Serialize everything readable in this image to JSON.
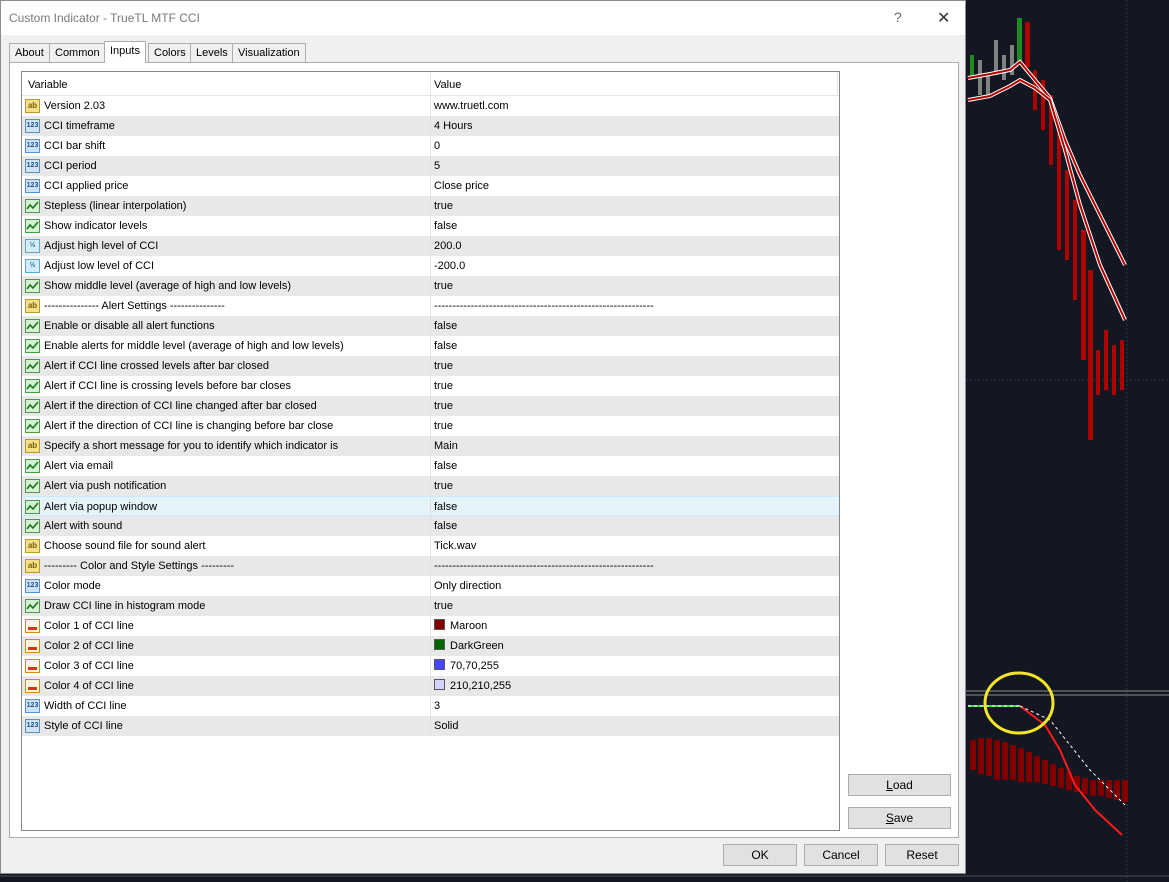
{
  "window": {
    "title": "Custom Indicator - TrueTL MTF CCI",
    "help": "?",
    "close": "✕"
  },
  "tabs": [
    "About",
    "Common",
    "Inputs",
    "Colors",
    "Levels",
    "Visualization"
  ],
  "active_tab": "Inputs",
  "grid": {
    "col_variable": "Variable",
    "col_value": "Value",
    "rows": [
      {
        "icon": "ab",
        "variable": "Version 2.03",
        "value": "www.truetl.com"
      },
      {
        "icon": "123",
        "variable": "CCI timeframe",
        "value": "4 Hours"
      },
      {
        "icon": "123",
        "variable": "CCI bar shift",
        "value": "0"
      },
      {
        "icon": "123",
        "variable": "CCI period",
        "value": "5"
      },
      {
        "icon": "123",
        "variable": "CCI applied price",
        "value": "Close price"
      },
      {
        "icon": "bool",
        "variable": "Stepless (linear interpolation)",
        "value": "true"
      },
      {
        "icon": "bool",
        "variable": "Show indicator levels",
        "value": "false"
      },
      {
        "icon": "½",
        "variable": "Adjust high level of CCI",
        "value": "200.0"
      },
      {
        "icon": "½",
        "variable": "Adjust low level of CCI",
        "value": "-200.0"
      },
      {
        "icon": "bool",
        "variable": "Show middle level (average of high and low levels)",
        "value": "true"
      },
      {
        "icon": "ab",
        "variable": "--------------- Alert Settings ---------------",
        "value": "------------------------------------------------------------"
      },
      {
        "icon": "bool",
        "variable": "Enable or disable all alert functions",
        "value": "false"
      },
      {
        "icon": "bool",
        "variable": "Enable alerts for middle level (average of high and low levels)",
        "value": "false"
      },
      {
        "icon": "bool",
        "variable": "Alert if CCI line crossed levels after bar closed",
        "value": "true"
      },
      {
        "icon": "bool",
        "variable": "Alert if CCI line is crossing levels before bar closes",
        "value": "true"
      },
      {
        "icon": "bool",
        "variable": "Alert if the direction of CCI line changed after bar closed",
        "value": "true"
      },
      {
        "icon": "bool",
        "variable": "Alert if the direction of CCI line is changing before bar close",
        "value": "true"
      },
      {
        "icon": "ab",
        "variable": "Specify a short message for you to identify which indicator is",
        "value": "Main"
      },
      {
        "icon": "bool",
        "variable": "Alert via email",
        "value": "false"
      },
      {
        "icon": "bool",
        "variable": "Alert via push notification",
        "value": "true"
      },
      {
        "icon": "bool",
        "variable": "Alert via popup window",
        "value": "false"
      },
      {
        "icon": "bool",
        "variable": "Alert with sound",
        "value": "false"
      },
      {
        "icon": "ab",
        "variable": "Choose sound file for sound alert",
        "value": "Tick.wav"
      },
      {
        "icon": "ab",
        "variable": "--------- Color and Style Settings ---------",
        "value": "------------------------------------------------------------"
      },
      {
        "icon": "123",
        "variable": "Color mode",
        "value": "Only direction"
      },
      {
        "icon": "bool",
        "variable": "Draw CCI line in histogram mode",
        "value": "true"
      },
      {
        "icon": "color",
        "variable": "Color 1 of CCI line",
        "value": "Maroon",
        "swatch": "#800000"
      },
      {
        "icon": "color",
        "variable": "Color 2 of CCI line",
        "value": "DarkGreen",
        "swatch": "#006400"
      },
      {
        "icon": "color",
        "variable": "Color 3 of CCI line",
        "value": "70,70,255",
        "swatch": "#4646ff"
      },
      {
        "icon": "color",
        "variable": "Color 4 of CCI line",
        "value": "210,210,255",
        "swatch": "#d2d2ff"
      },
      {
        "icon": "123",
        "variable": "Width of CCI line",
        "value": "3"
      },
      {
        "icon": "123",
        "variable": "Style of CCI line",
        "value": "Solid"
      }
    ],
    "selected_row": 20
  },
  "buttons": {
    "load": {
      "pre": "",
      "ul": "L",
      "post": "oad"
    },
    "save": {
      "pre": "",
      "ul": "S",
      "post": "ave"
    },
    "ok": "OK",
    "cancel": "Cancel",
    "reset": "Reset"
  },
  "colors": {
    "background": "#131722",
    "bear": "#b00000",
    "bull": "#1f8a1f",
    "highlight": "#f5e52a"
  }
}
